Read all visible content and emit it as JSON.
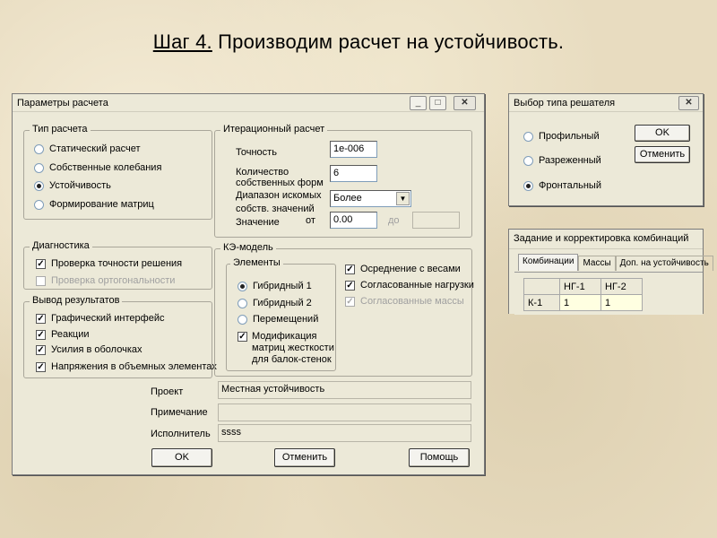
{
  "slide": {
    "step_label": "Шаг 4.",
    "title_text": "Производим расчет на устойчивость."
  },
  "params_dialog": {
    "title": "Параметры расчета",
    "calc_type": {
      "title": "Тип расчета",
      "options": [
        {
          "label": "Статический расчет",
          "selected": false
        },
        {
          "label": "Собственные колебания",
          "selected": false
        },
        {
          "label": "Устойчивость",
          "selected": true
        },
        {
          "label": "Формирование матриц",
          "selected": false
        }
      ]
    },
    "iteration": {
      "title": "Итерационный расчет",
      "precision_label": "Точность",
      "precision_value": "1e-006",
      "count_label_1": "Количество",
      "count_label_2": "собственных форм",
      "count_value": "6",
      "range_label_1": "Диапазон искомых",
      "range_label_2": "собств. значений",
      "range_select": "Более",
      "value_label": "Значение",
      "from_label": "от",
      "from_value": "0.00",
      "to_label": "до",
      "to_value": ""
    },
    "diagnostics": {
      "title": "Диагностика",
      "items": [
        {
          "label": "Проверка точности решения",
          "checked": true,
          "enabled": true
        },
        {
          "label": "Проверка ортогональности",
          "checked": false,
          "enabled": false
        }
      ]
    },
    "output": {
      "title": "Вывод результатов",
      "items": [
        {
          "label": "Графический интерфейс",
          "checked": true
        },
        {
          "label": "Реакции",
          "checked": true
        },
        {
          "label": "Усилия в оболочках",
          "checked": true
        },
        {
          "label": "Напряжения в объемных элементах",
          "checked": true
        }
      ]
    },
    "fe_model": {
      "title": "КЭ-модель",
      "elements_title": "Элементы",
      "elements": [
        {
          "label": "Гибридный 1",
          "selected": true
        },
        {
          "label": "Гибридный 2",
          "selected": false
        },
        {
          "label": "Перемещений",
          "selected": false
        }
      ],
      "modification_label_1": "Модификация",
      "modification_label_2": "матриц жесткости",
      "modification_label_3": "для балок-стенок",
      "modification_checked": true,
      "right_options": [
        {
          "label": "Осреднение с весами",
          "checked": true,
          "enabled": true
        },
        {
          "label": "Согласованные нагрузки",
          "checked": true,
          "enabled": true
        },
        {
          "label": "Согласованные массы",
          "checked": true,
          "enabled": false
        }
      ]
    },
    "project_label": "Проект",
    "project_value": "Местная устойчивость",
    "note_label": "Примечание",
    "note_value": "",
    "executor_label": "Исполнитель",
    "executor_value": "ssss",
    "ok_label": "OK",
    "cancel_label": "Отменить",
    "help_label": "Помощь"
  },
  "solver_dialog": {
    "title": "Выбор типа решателя",
    "options": [
      {
        "label": "Профильный",
        "selected": false
      },
      {
        "label": "Разреженный",
        "selected": false
      },
      {
        "label": "Фронтальный",
        "selected": true
      }
    ],
    "ok_label": "OK",
    "cancel_label": "Отменить"
  },
  "combo_dialog": {
    "title": "Задание и корректировка комбинаций",
    "tabs": [
      {
        "label": "Комбинации",
        "active": true
      },
      {
        "label": "Массы",
        "active": false
      },
      {
        "label": "Доп. на устойчивость",
        "active": false
      }
    ],
    "headers": [
      "",
      "НГ-1",
      "НГ-2"
    ],
    "rows": [
      {
        "label": "К-1",
        "values": [
          "1",
          "1"
        ]
      }
    ]
  },
  "colors": {
    "background": "#e8dcc0",
    "window": "#ece9d8",
    "cell_highlight": "#ffffe1"
  }
}
